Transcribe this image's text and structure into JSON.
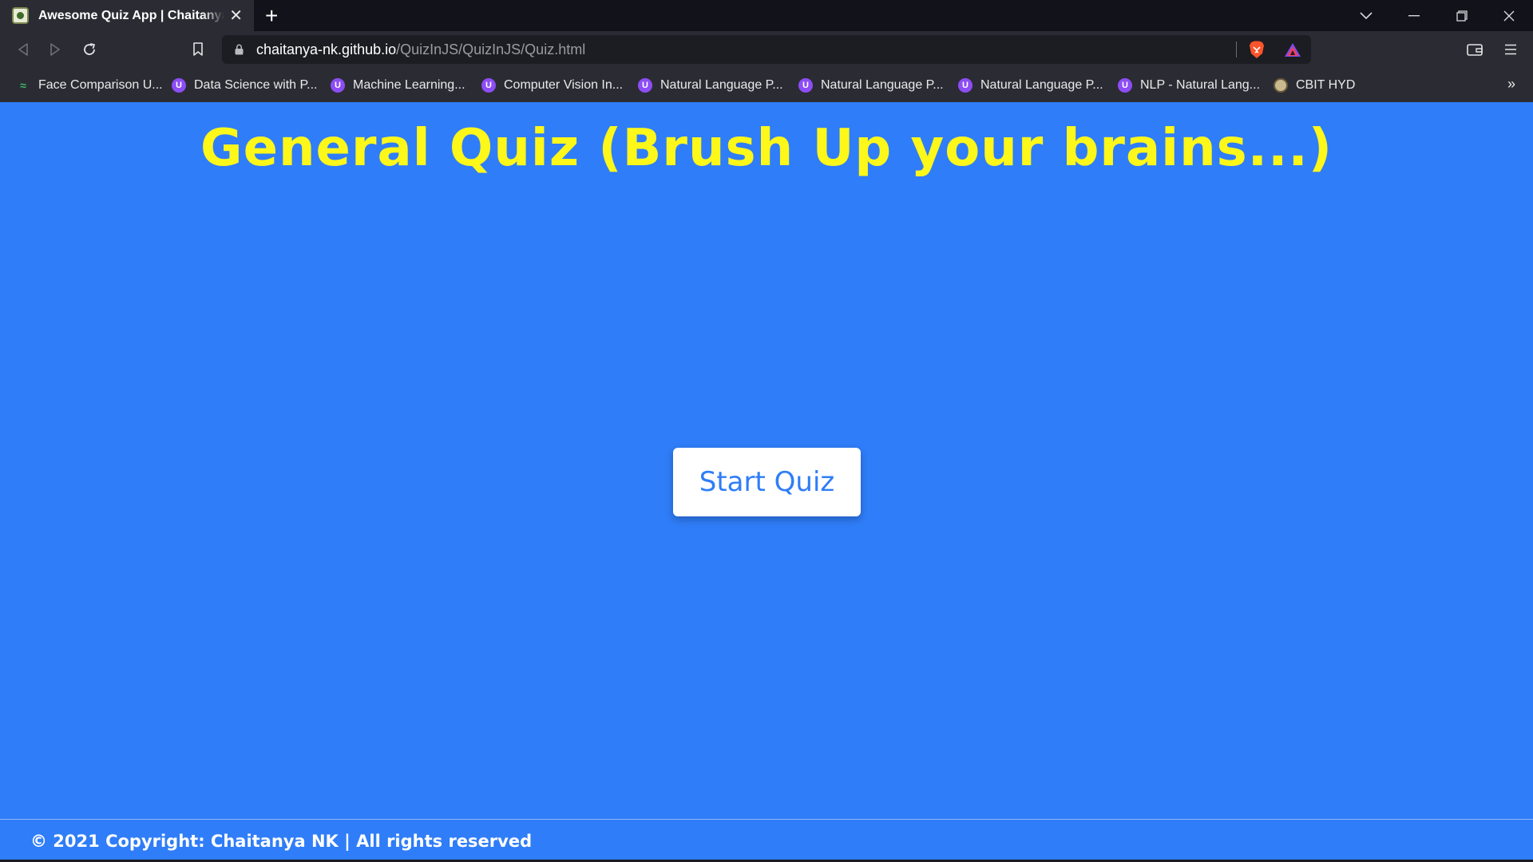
{
  "browser": {
    "tab": {
      "title": "Awesome Quiz App | ChaitanyaNK",
      "favicon": "quiz-app-favicon",
      "close_icon": "close-icon"
    },
    "new_tab_icon": "plus-icon",
    "window_controls": [
      "chevron-down-icon",
      "minimize-icon",
      "restore-icon",
      "close-icon"
    ],
    "address_bar": {
      "host": "chaitanya-nk.github.io",
      "path": "/QuizInJS/QuizInJS/Quiz.html"
    },
    "bookmarks": [
      {
        "label": "Face Comparison U...",
        "icon": "face-comparison-icon"
      },
      {
        "label": "Data Science with P...",
        "icon": "udemy-icon"
      },
      {
        "label": "Machine Learning...",
        "icon": "udemy-icon"
      },
      {
        "label": "Computer Vision In...",
        "icon": "udemy-icon"
      },
      {
        "label": "Natural Language P...",
        "icon": "udemy-icon"
      },
      {
        "label": "Natural Language P...",
        "icon": "udemy-icon"
      },
      {
        "label": "Natural Language P...",
        "icon": "udemy-icon"
      },
      {
        "label": "NLP - Natural Lang...",
        "icon": "udemy-icon"
      },
      {
        "label": "CBIT HYD",
        "icon": "cbit-crest-icon"
      }
    ],
    "bookmarks_overflow": "»"
  },
  "page": {
    "title": "General Quiz (Brush Up your brains...)",
    "start_button": "Start Quiz",
    "footer": "© 2021 Copyright: Chaitanya NK | All rights reserved"
  },
  "colors": {
    "page_background": "#2f7df8",
    "title": "#fdf71a",
    "button_text": "#2f7df8",
    "button_background": "#ffffff"
  }
}
